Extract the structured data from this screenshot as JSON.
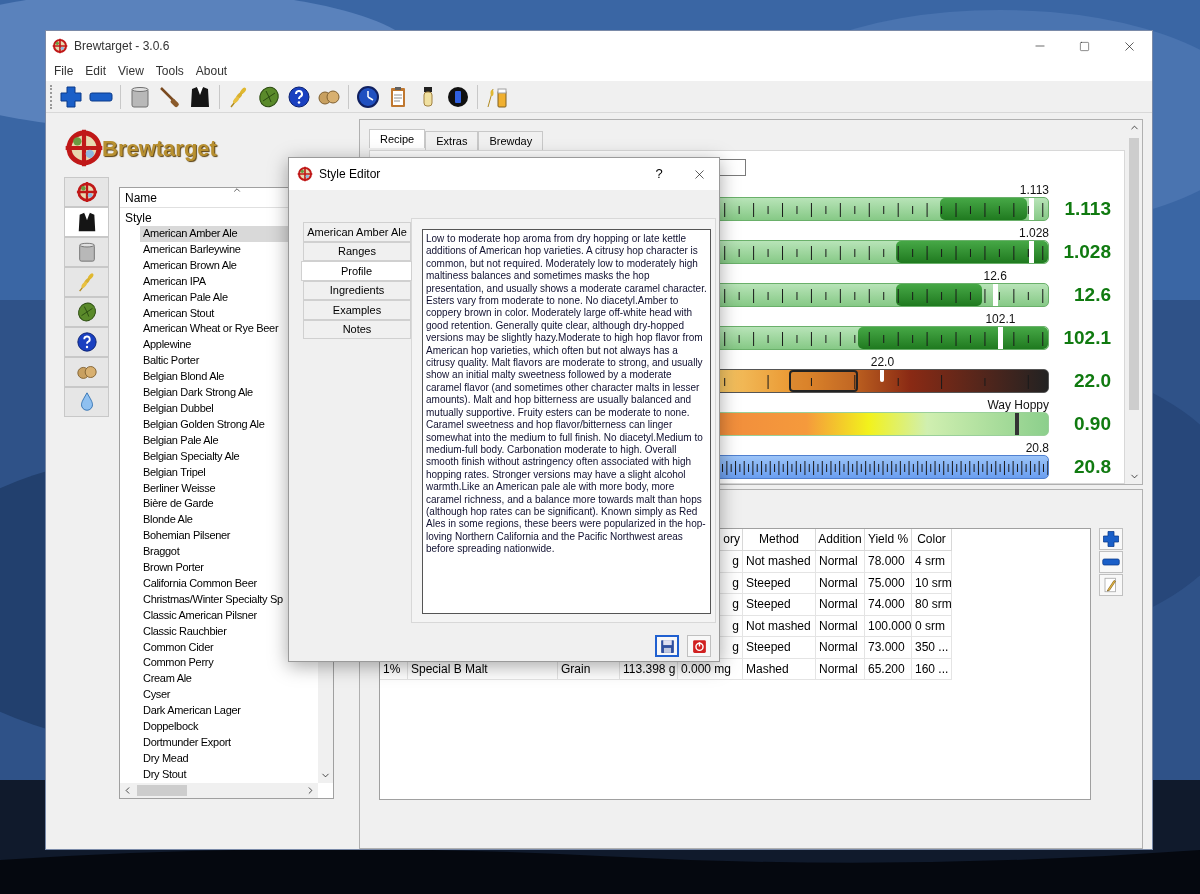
{
  "window": {
    "title": "Brewtarget - 3.0.6"
  },
  "menu": [
    "File",
    "Edit",
    "View",
    "Tools",
    "About"
  ],
  "logo": {
    "text": "Brewtarget"
  },
  "side_tabs": [
    {
      "selected": false
    },
    {
      "selected": true
    },
    {
      "selected": false
    },
    {
      "selected": false
    },
    {
      "selected": false
    },
    {
      "selected": false
    },
    {
      "selected": false
    },
    {
      "selected": false
    }
  ],
  "style_list": {
    "header": "Name",
    "root": {
      "label": "Style",
      "children": [
        {
          "label": "American Amber Ale",
          "selected": true
        },
        {
          "label": "American Barleywine",
          "selected": false
        },
        {
          "label": "American Brown Ale",
          "selected": false
        },
        {
          "label": "American IPA",
          "selected": false
        },
        {
          "label": "American Pale Ale",
          "selected": false
        },
        {
          "label": "American Stout",
          "selected": false
        },
        {
          "label": "American Wheat or Rye Beer",
          "selected": false
        },
        {
          "label": "Applewine",
          "selected": false
        },
        {
          "label": "Baltic Porter",
          "selected": false
        },
        {
          "label": "Belgian Blond Ale",
          "selected": false
        },
        {
          "label": "Belgian Dark Strong Ale",
          "selected": false
        },
        {
          "label": "Belgian Dubbel",
          "selected": false
        },
        {
          "label": "Belgian Golden Strong Ale",
          "selected": false
        },
        {
          "label": "Belgian Pale Ale",
          "selected": false
        },
        {
          "label": "Belgian Specialty Ale",
          "selected": false
        },
        {
          "label": "Belgian Tripel",
          "selected": false
        },
        {
          "label": "Berliner Weisse",
          "selected": false
        },
        {
          "label": "Bière de Garde",
          "selected": false
        },
        {
          "label": "Blonde Ale",
          "selected": false
        },
        {
          "label": "Bohemian Pilsener",
          "selected": false
        },
        {
          "label": "Braggot",
          "selected": false
        },
        {
          "label": "Brown Porter",
          "selected": false
        },
        {
          "label": "California Common Beer",
          "selected": false
        },
        {
          "label": "Christmas/Winter Specialty Sp",
          "selected": false
        },
        {
          "label": "Classic American Pilsner",
          "selected": false
        },
        {
          "label": "Classic Rauchbier",
          "selected": false
        },
        {
          "label": "Common Cider",
          "selected": false
        },
        {
          "label": "Common Perry",
          "selected": false
        },
        {
          "label": "Cream Ale",
          "selected": false
        },
        {
          "label": "Cyser",
          "selected": false
        },
        {
          "label": "Dark American Lager",
          "selected": false
        },
        {
          "label": "Doppelbock",
          "selected": false
        },
        {
          "label": "Dortmunder Export",
          "selected": false
        },
        {
          "label": "Dry Mead",
          "selected": false
        },
        {
          "label": "Dry Stout",
          "selected": false
        }
      ]
    }
  },
  "main_tabs": [
    {
      "label": "Recipe",
      "selected": true
    },
    {
      "label": "Extras",
      "selected": false
    },
    {
      "label": "Brewday",
      "selected": false
    }
  ],
  "gauges": [
    {
      "kind": "green",
      "marker_label": "1.113",
      "value": "1.113",
      "level": 0.95
    },
    {
      "kind": "green",
      "marker_label": "1.028",
      "value": "1.028",
      "level": 0.95
    },
    {
      "kind": "green",
      "marker_label": "12.6",
      "value": "12.6",
      "level": 0.845
    },
    {
      "kind": "green",
      "marker_label": "102.1",
      "value": "102.1",
      "level": 0.86
    },
    {
      "kind": "color",
      "marker_label": "22.0",
      "value": "22.0",
      "level": 0.52
    },
    {
      "kind": "ratio",
      "marker_label": "Way Hoppy",
      "value": "0.90",
      "level": 0.91
    },
    {
      "kind": "blue",
      "marker_label": "20.8",
      "value": "20.8"
    }
  ],
  "ingredients_table": {
    "columns": [
      "ory",
      "Method",
      "Addition",
      "Yield %",
      "Color"
    ],
    "rows": [
      {
        "cells": [
          "g",
          "Not mashed",
          "Normal",
          "78.000",
          "4 srm"
        ]
      },
      {
        "cells": [
          "g",
          "Steeped",
          "Normal",
          "75.000",
          "10 srm"
        ]
      },
      {
        "cells": [
          "g",
          "Steeped",
          "Normal",
          "74.000",
          "80 srm"
        ]
      },
      {
        "cells": [
          "g",
          "Not mashed",
          "Normal",
          "100.000",
          "0 srm"
        ]
      },
      {
        "cells": [
          "g",
          "Steeped",
          "Normal",
          "73.000",
          "350 ..."
        ]
      },
      {
        "cells": [
          "1%",
          "Special B Malt",
          "Grain",
          "113.398 g",
          "0.000 mg",
          "Mashed",
          "Normal",
          "65.200",
          "160 ..."
        ]
      }
    ]
  },
  "style_editor": {
    "title": "Style Editor",
    "help": "?",
    "tabs": [
      {
        "label": "American Amber Ale",
        "selected": false
      },
      {
        "label": "Ranges",
        "selected": false
      },
      {
        "label": "Profile",
        "selected": true
      },
      {
        "label": "Ingredients",
        "selected": false
      },
      {
        "label": "Examples",
        "selected": false
      },
      {
        "label": "Notes",
        "selected": false
      }
    ],
    "text": "Low to moderate hop aroma from dry hopping or late kettle additions of American hop varieties. A citrusy hop character is common, but not required. Moderately low to moderately high maltiness balances and sometimes masks the hop presentation, and usually shows a moderate caramel character. Esters vary from moderate to none. No diacetyl.Amber to coppery brown in color. Moderately large off-white head with good retention. Generally quite clear, although dry-hopped versions may be slightly hazy.Moderate to high hop flavor from American hop varieties, which often but not always has a citrusy quality. Malt flavors are moderate to strong, and usually show an initial malty sweetness followed by a moderate caramel flavor (and sometimes other character malts in lesser amounts). Malt and hop bitterness are usually balanced and mutually supportive. Fruity esters can be moderate to none. Caramel sweetness and hop flavor/bitterness can linger somewhat into the medium to full finish. No diacetyl.Medium to medium-full body. Carbonation moderate to high. Overall smooth finish without astringency often associated with high hopping rates. Stronger versions may have a slight alcohol warmth.Like an American pale ale with more body, more caramel richness, and a balance more towards malt than hops (although hop rates can be significant). Known simply as Red Ales in some regions, these beers were popularized in the hop-loving Northern California and the Pacific Northwest areas before spreading nationwide."
  }
}
